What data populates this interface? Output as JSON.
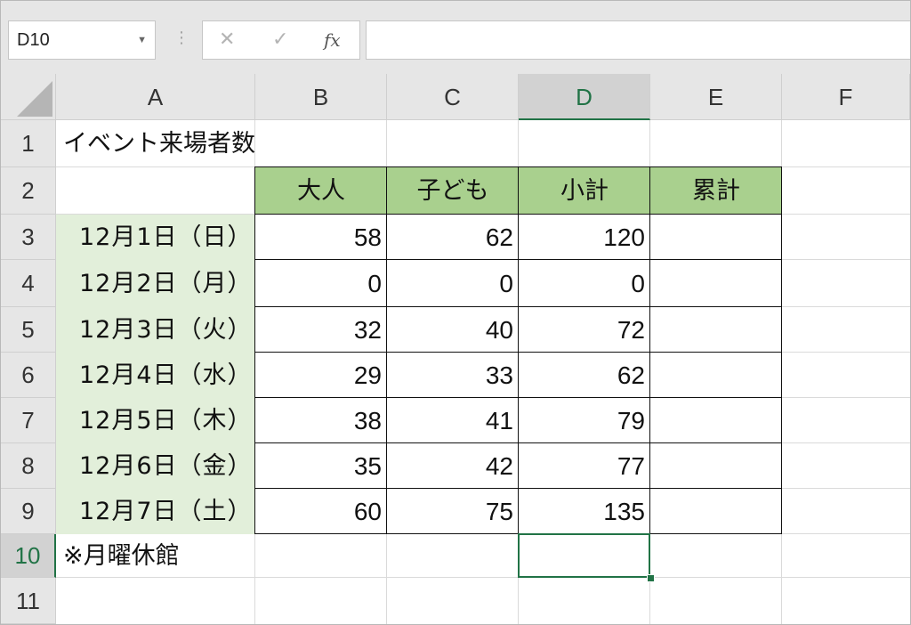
{
  "formula_bar": {
    "name_box": "D10",
    "cancel_icon": "✕",
    "enter_icon": "✓",
    "fx_label": "fx",
    "formula": ""
  },
  "columns": [
    "A",
    "B",
    "C",
    "D",
    "E",
    "F"
  ],
  "rows": [
    "1",
    "2",
    "3",
    "4",
    "5",
    "6",
    "7",
    "8",
    "9",
    "10",
    "11"
  ],
  "selected": {
    "column": "D",
    "row": "10"
  },
  "sheet": {
    "title": "イベント来場者数",
    "headers": [
      "大人",
      "子ども",
      "小計",
      "累計"
    ],
    "data": [
      {
        "date": "12月1日（日）",
        "adult": "58",
        "child": "62",
        "subtotal": "120",
        "cumulative": ""
      },
      {
        "date": "12月2日（月）",
        "adult": "0",
        "child": "0",
        "subtotal": "0",
        "cumulative": ""
      },
      {
        "date": "12月3日（火）",
        "adult": "32",
        "child": "40",
        "subtotal": "72",
        "cumulative": ""
      },
      {
        "date": "12月4日（水）",
        "adult": "29",
        "child": "33",
        "subtotal": "62",
        "cumulative": ""
      },
      {
        "date": "12月5日（木）",
        "adult": "38",
        "child": "41",
        "subtotal": "79",
        "cumulative": ""
      },
      {
        "date": "12月6日（金）",
        "adult": "35",
        "child": "42",
        "subtotal": "77",
        "cumulative": ""
      },
      {
        "date": "12月7日（土）",
        "adult": "60",
        "child": "75",
        "subtotal": "135",
        "cumulative": ""
      }
    ],
    "note": "※月曜休館"
  },
  "colors": {
    "header_fill": "#a9d08e",
    "date_fill": "#e2efda",
    "accent": "#217346"
  }
}
